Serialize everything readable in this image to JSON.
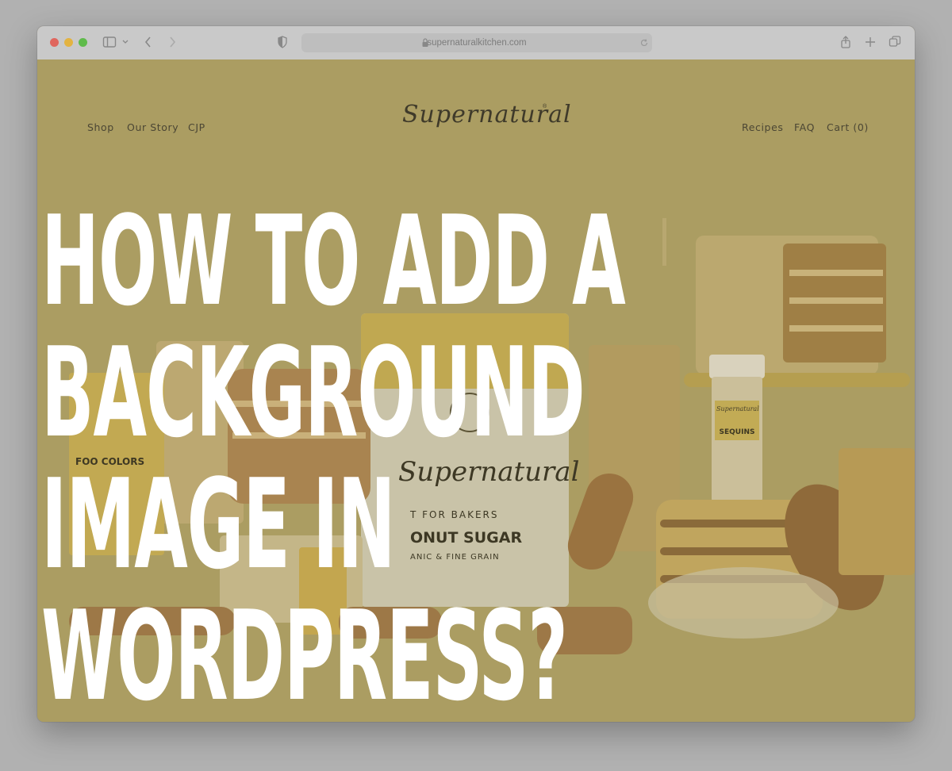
{
  "browser": {
    "url": "supernaturalkitchen.com",
    "traffic_lights": {
      "close": "#e0665e",
      "minimize": "#e3b341",
      "zoom": "#5fbb4b"
    }
  },
  "site": {
    "logo": "Supernatural",
    "nav_left": [
      "Shop",
      "Our Story",
      "CJP"
    ],
    "nav_right": [
      "Recipes",
      "FAQ",
      "Cart (0)"
    ]
  },
  "background_products": {
    "bag_brand": "Supernatural",
    "bag_line1": "T FOR BAKERS",
    "bag_line2": "ONUT SUGAR",
    "bag_line3": "ANIC & FINE GRAIN",
    "jar_brand": "Supernatural",
    "jar_label": "SEQUINS",
    "box_label": "FOO COLORS"
  },
  "overlay": {
    "headline_lines": [
      "HOW TO ADD A",
      "BACKGROUND",
      "IMAGE IN",
      "WORDPRESS?"
    ]
  },
  "colors": {
    "page_bg": "#ab9d62",
    "overlay_text": "#ffffff"
  }
}
